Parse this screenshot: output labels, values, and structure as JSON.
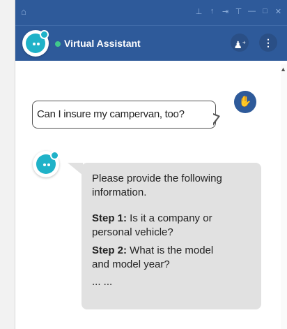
{
  "colors": {
    "brand": "#2e5a9a",
    "accent": "#1fb2c8",
    "online": "#40c98c",
    "bot_bubble": "#e1e1e1"
  },
  "titlebar": {
    "home_icon": "home-icon",
    "controls": [
      "pin-icon",
      "pin-up-icon",
      "dock-icon",
      "dock-top-icon",
      "minimize-icon",
      "maximize-icon",
      "close-icon"
    ]
  },
  "header": {
    "title": "Virtual Assistant",
    "status": "online",
    "add_user_icon": "add-user-icon",
    "more_icon": "more-vertical-icon"
  },
  "messages": {
    "user": {
      "text": "Can I insure my campervan, too?"
    },
    "bot": {
      "intro_line1": "Please provide the following",
      "intro_line2": "information.",
      "step1_label": "Step 1:",
      "step1_text": " Is it a company or",
      "step1_text2": "personal vehicle?",
      "step2_label": "Step 2:",
      "step2_text": " What is the model",
      "step2_text2": "and model year?",
      "ellipsis": "... ..."
    }
  }
}
